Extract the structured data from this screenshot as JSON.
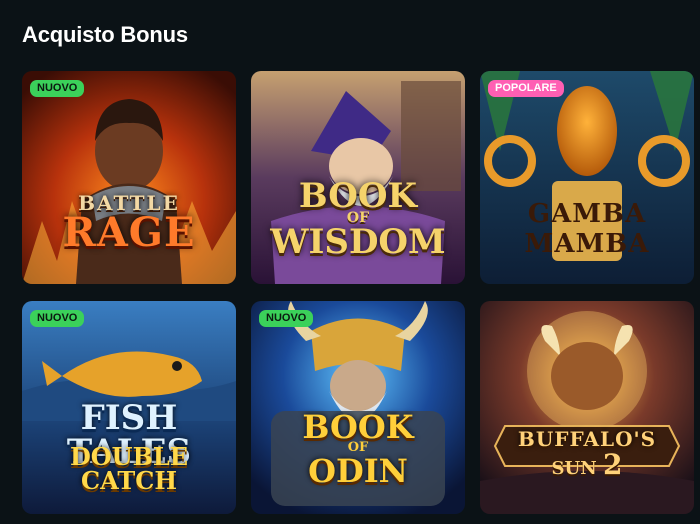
{
  "section": {
    "title": "Acquisto Bonus"
  },
  "games": [
    {
      "name": "Battle Rage",
      "line1": "BATTLE",
      "line2": "RAGE",
      "badge": "NUOVO"
    },
    {
      "name": "Book of Wisdom",
      "line1": "BOOK",
      "line_mid": "OF",
      "line2": "WISDOM",
      "badge": ""
    },
    {
      "name": "Gamba Mamba",
      "line1": "GAMBA",
      "line2": "MAMBA",
      "badge": "POPOLARE"
    },
    {
      "name": "Fish Tales Double Catch",
      "line1": "FISH TALES",
      "line2": "DOUBLE CATCH",
      "badge": "NUOVO"
    },
    {
      "name": "Book of Odin",
      "line1": "BOOK",
      "line_mid": "OF",
      "line2": "ODIN",
      "badge": "NUOVO"
    },
    {
      "name": "Buffalo's Sun 2",
      "line1": "BUFFALO'S",
      "line2": "SUN",
      "line_num": "2",
      "badge": ""
    }
  ],
  "colors": {
    "background": "#0b1216",
    "badge_new": "#3bd15a",
    "badge_popular": "#ff5fb3"
  }
}
